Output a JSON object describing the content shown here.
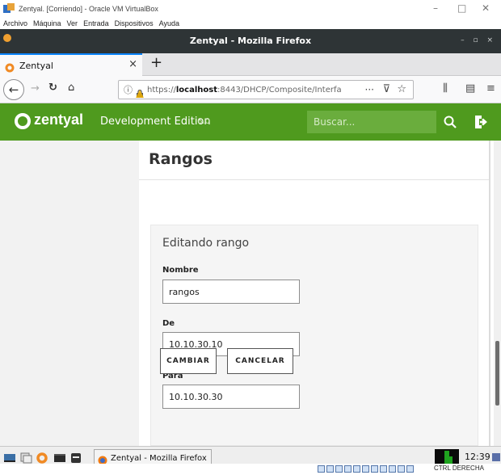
{
  "virtualbox": {
    "window_title": "Zentyal. [Corriendo] - Oracle VM VirtualBox",
    "minimize": "–",
    "maximize": "□",
    "close": "✕",
    "menu": [
      "Archivo",
      "Máquina",
      "Ver",
      "Entrada",
      "Dispositivos",
      "Ayuda"
    ],
    "host_key": "CTRL DERECHA"
  },
  "firefox": {
    "window_title": "Zentyal - Mozilla Firefox",
    "window_controls": "– ▫ ×",
    "tab": {
      "label": "Zentyal",
      "close": "×"
    },
    "new_tab": "+",
    "url": {
      "scheme": "https://",
      "host": "localhost",
      "rest": ":8443/DHCP/Composite/Interfa"
    },
    "page_actions": "···"
  },
  "header": {
    "logo": "zentyal",
    "edition": "Development Edition",
    "version": "6.0",
    "search_placeholder": "Buscar...",
    "brand_color": "#4f9a1e"
  },
  "main": {
    "title": "Rangos",
    "form": {
      "heading": "Editando rango",
      "fields": [
        {
          "label": "Nombre",
          "value": "rangos"
        },
        {
          "label": "De",
          "value": "10.10.30.10"
        },
        {
          "label": "Para",
          "value": "10.10.30.30"
        }
      ],
      "change_button": "CAMBIAR",
      "cancel_button": "CANCELAR"
    }
  },
  "taskbar": {
    "task_label": "Zentyal - Mozilla Firefox",
    "clock": "12:39"
  }
}
